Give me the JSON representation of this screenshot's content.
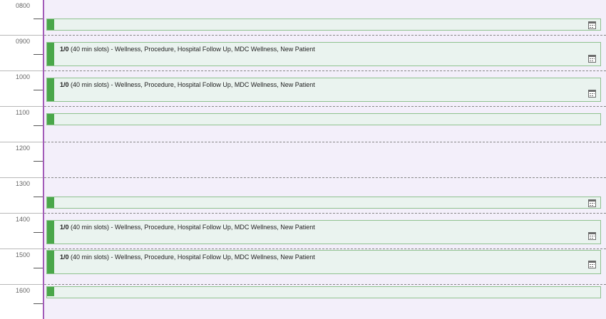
{
  "hours": [
    "0800",
    "0900",
    "1000",
    "1100",
    "1200",
    "1300",
    "1400",
    "1500",
    "1600"
  ],
  "slot_text": {
    "count": "1/0",
    "description": " (40 min slots) - Wellness, Procedure, Hospital Follow Up, MDC Wellness, New Patient"
  },
  "colors": {
    "available": "#4aa74a",
    "timeline": "#a25bb8",
    "background": "#f3effa"
  },
  "icons": {
    "slot_action": "calendar-icon"
  }
}
